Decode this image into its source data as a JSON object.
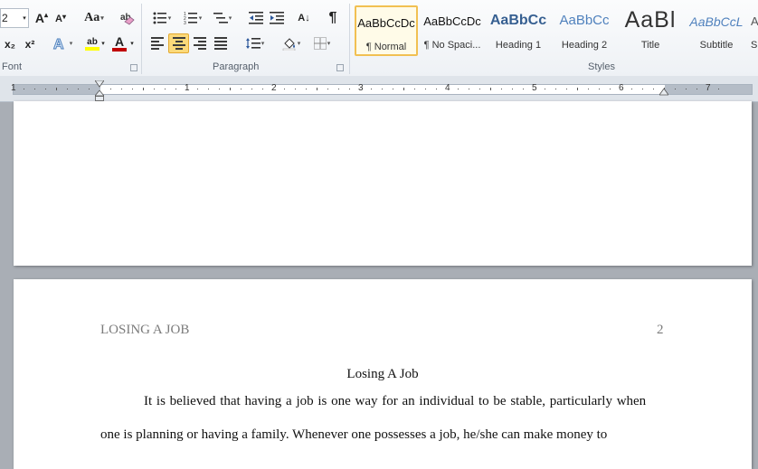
{
  "ribbon": {
    "font_group": {
      "label": "Font",
      "font_size": "2",
      "grow_glyph": "A",
      "shrink_glyph": "A",
      "change_case": "Aa",
      "highlight_glyph": "ab",
      "font_color_glyph": "A",
      "subscript": "x₂",
      "superscript": "x²"
    },
    "paragraph_group": {
      "label": "Paragraph",
      "show_marks": "¶",
      "sort_glyph": "A↓"
    },
    "styles_group": {
      "label": "Styles",
      "items": [
        {
          "sample": "AaBbCcDc",
          "name": "¶ Normal"
        },
        {
          "sample": "AaBbCcDc",
          "name": "¶ No Spaci..."
        },
        {
          "sample": "AaBbCc",
          "name": "Heading 1"
        },
        {
          "sample": "AaBbCc",
          "name": "Heading 2"
        },
        {
          "sample": "AaBl",
          "name": "Title"
        },
        {
          "sample": "AaBbCcL",
          "name": "Subtitle"
        },
        {
          "sample": "Aa",
          "name": "Su"
        }
      ]
    }
  },
  "ruler": {
    "numbers": [
      "1",
      "1",
      "2",
      "3",
      "4",
      "5",
      "6",
      "7"
    ]
  },
  "document": {
    "header_text": "LOSING A JOB",
    "page_number": "2",
    "title": "Losing A Job",
    "line1": "It is believed that having a job is one way for an individual to be stable, particularly when",
    "line2": "one is planning or having a family. Whenever one possesses a job, he/she can make money to"
  },
  "colors": {
    "heading_blue": "#365f91",
    "heading2_blue": "#4f81bd",
    "subtitle_blue": "#4f81bd",
    "font_color_red": "#c00000",
    "highlight_yellow": "#ffff00",
    "active_button": "#fbd97a"
  }
}
